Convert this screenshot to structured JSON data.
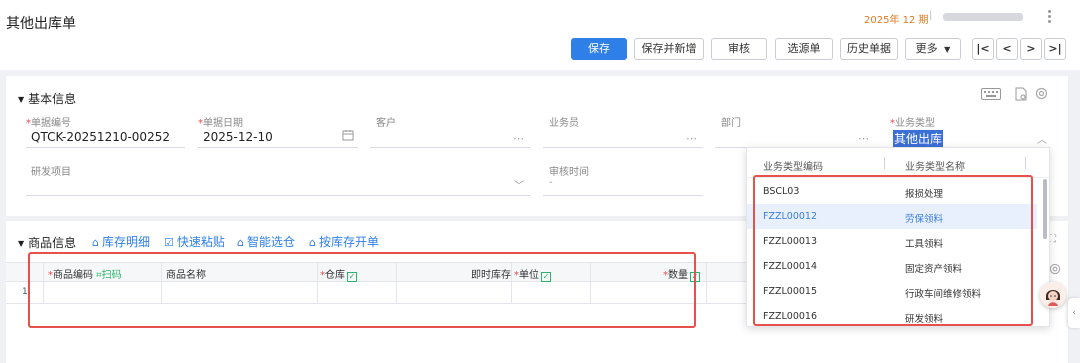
{
  "page": {
    "title": "其他出库单"
  },
  "topbar": {
    "period": "2025年 12 期",
    "separator": "|"
  },
  "toolbar": {
    "save": "保存",
    "save_new": "保存并新增",
    "audit": "审核",
    "source": "选源单",
    "history": "历史单据",
    "more": "更多",
    "nav_first": "|<",
    "nav_prev": "<",
    "nav_next": ">",
    "nav_last": ">|"
  },
  "basic": {
    "title": "基本信息",
    "doc_no": {
      "label": "单据编号",
      "value": "QTCK-20251210-00252"
    },
    "doc_date": {
      "label": "单据日期",
      "value": "2025-12-10"
    },
    "customer": {
      "label": "客户",
      "value": ""
    },
    "salesman": {
      "label": "业务员",
      "value": ""
    },
    "dept": {
      "label": "部门",
      "value": ""
    },
    "biz_type": {
      "label": "业务类型",
      "value": "其他出库"
    },
    "rd_project": {
      "label": "研发项目",
      "value": ""
    },
    "audit_time": {
      "label": "审核时间",
      "value": "-"
    }
  },
  "goods": {
    "title": "商品信息",
    "links": [
      "库存明细",
      "快速粘贴",
      "智能选仓",
      "按库存开单"
    ],
    "columns": {
      "code": "商品编码",
      "scan": "扫码",
      "name": "商品名称",
      "warehouse": "仓库",
      "stock": "即时库存",
      "unit": "单位",
      "qty": "数量"
    },
    "row_number": "1"
  },
  "dropdown": {
    "head_code": "业务类型编码",
    "head_name": "业务类型名称",
    "items": [
      {
        "code": "BSCL03",
        "name": "报损处理"
      },
      {
        "code": "FZZL00012",
        "name": "劳保领料"
      },
      {
        "code": "FZZL00013",
        "name": "工具领料"
      },
      {
        "code": "FZZL00014",
        "name": "固定资产领料"
      },
      {
        "code": "FZZL00015",
        "name": "行政车间维修领料"
      },
      {
        "code": "FZZL00016",
        "name": "研发领料"
      }
    ],
    "selected_index": 1
  },
  "colors": {
    "accent": "#2f7fe8",
    "highlight": "#e8514a",
    "required": "#e14b4b",
    "period": "#e07a1f"
  }
}
